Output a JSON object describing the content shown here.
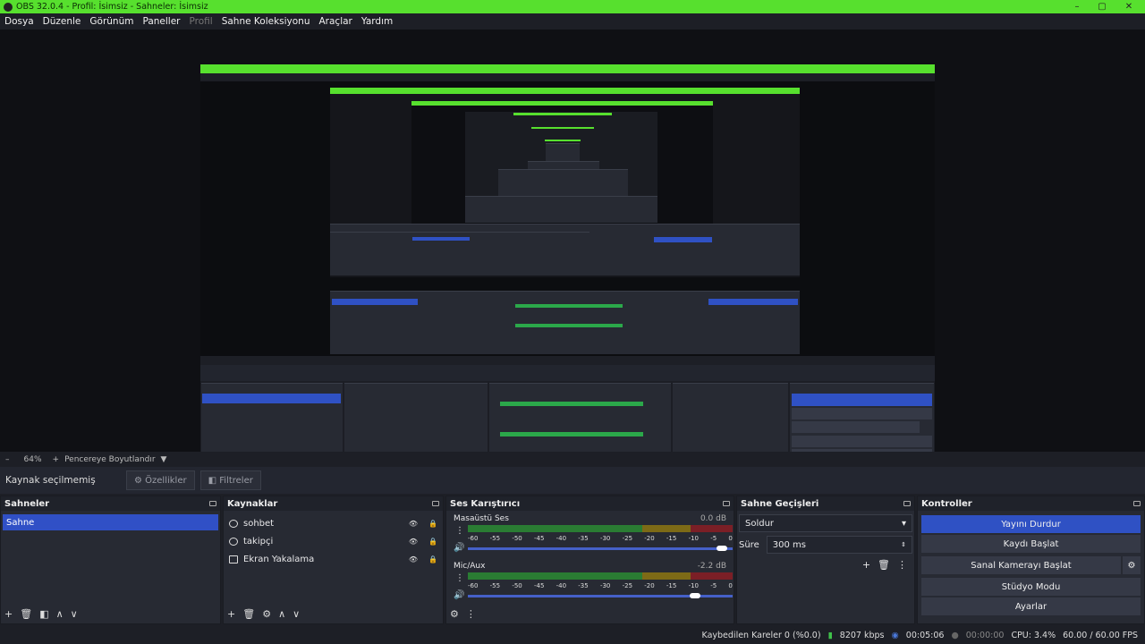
{
  "window": {
    "title": "OBS 32.0.4 - Profil: İsimsiz - Sahneler: İsimsiz",
    "minimize": "–",
    "maximize": "▢",
    "close": "✕"
  },
  "menu": [
    "Dosya",
    "Düzenle",
    "Görünüm",
    "Paneller",
    "Profil",
    "Sahne Koleksiyonu",
    "Araçlar",
    "Yardım"
  ],
  "zoom": {
    "minus": "–",
    "value": "64%",
    "plus": "+",
    "fit_label": "Pencereye Boyutlandır"
  },
  "source_bar": {
    "none_selected": "Kaynak seçilmemiş",
    "properties": "Özellikler",
    "filters": "Filtreler"
  },
  "docks": {
    "scenes": {
      "title": "Sahneler",
      "items": [
        "Sahne"
      ],
      "selected": 0
    },
    "sources": {
      "title": "Kaynaklar",
      "items": [
        {
          "name": "sohbet",
          "icon": "browser-icon"
        },
        {
          "name": "takipçi",
          "icon": "browser-icon"
        },
        {
          "name": "Ekran Yakalama",
          "icon": "display-capture-icon"
        }
      ]
    },
    "mixer": {
      "title": "Ses Karıştırıcı",
      "channels": [
        {
          "name": "Masaüstü Ses",
          "db": "0.0 dB",
          "level": 0.0
        },
        {
          "name": "Mic/Aux",
          "db": "-2.2 dB",
          "level": 0.0
        }
      ],
      "ticks": [
        "-60",
        "-55",
        "-50",
        "-45",
        "-40",
        "-35",
        "-30",
        "-25",
        "-20",
        "-15",
        "-10",
        "-5",
        "0"
      ]
    },
    "transitions": {
      "title": "Sahne Geçişleri",
      "selected": "Soldur",
      "duration_label": "Süre",
      "duration": "300 ms"
    },
    "controls": {
      "title": "Kontroller",
      "buttons": [
        "Yayını Durdur",
        "Kaydı Başlat",
        "Sanal Kamerayı Başlat",
        "Stüdyo Modu",
        "Ayarlar"
      ]
    }
  },
  "status": {
    "dropped": "Kaybedilen Kareler 0 (%0.0)",
    "bitrate": "8207 kbps",
    "stream_time": "00:05:06",
    "rec_time": "00:00:00",
    "cpu": "CPU: 3.4%",
    "fps": "60.00 / 60.00 FPS"
  },
  "colors": {
    "titlebar": "#57e02e",
    "accent": "#2f51c4"
  }
}
